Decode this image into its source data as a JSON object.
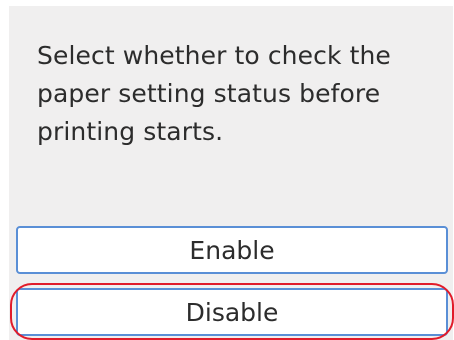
{
  "dialog": {
    "message_lines": [
      "Select whether to check the",
      "paper setting status before",
      "printing starts."
    ]
  },
  "options": {
    "enable_label": "Enable",
    "disable_label": "Disable"
  },
  "colors": {
    "panel_background": "#f0efef",
    "button_border": "#5a8fd6",
    "highlight": "#e11b2a"
  }
}
